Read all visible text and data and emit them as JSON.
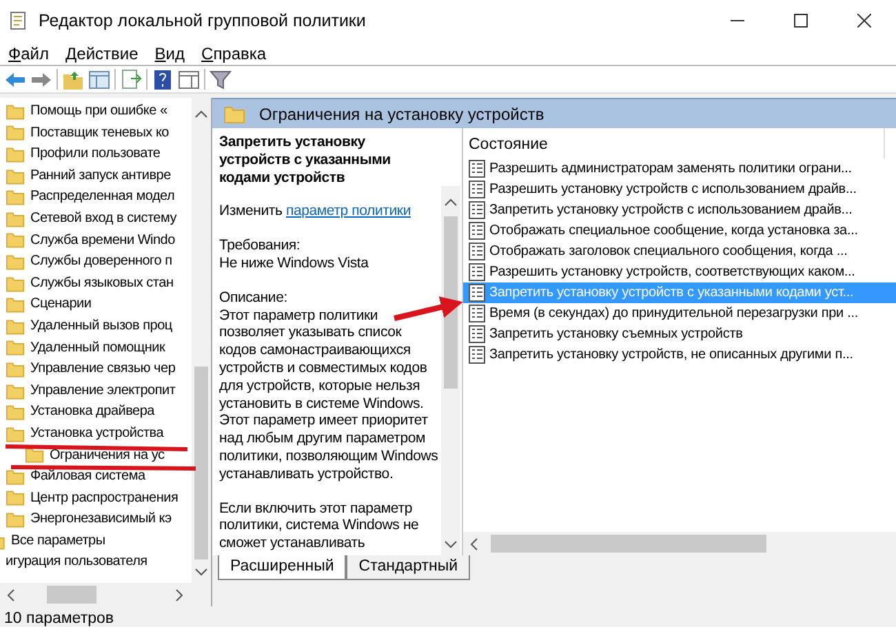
{
  "window": {
    "title": "Редактор локальной групповой политики"
  },
  "menu": [
    "Файл",
    "Действие",
    "Вид",
    "Справка"
  ],
  "tree": [
    {
      "label": "Помощь при ошибке «",
      "kind": "folder"
    },
    {
      "label": "Поставщик теневых ко",
      "kind": "folder"
    },
    {
      "label": "Профили пользовате",
      "kind": "folder"
    },
    {
      "label": "Ранний запуск антивре",
      "kind": "folder"
    },
    {
      "label": "Распределенная модел",
      "kind": "folder"
    },
    {
      "label": "Сетевой вход в систему",
      "kind": "folder"
    },
    {
      "label": "Служба времени Windo",
      "kind": "folder"
    },
    {
      "label": "Службы доверенного п",
      "kind": "folder"
    },
    {
      "label": "Службы языковых стан",
      "kind": "folder"
    },
    {
      "label": "Сценарии",
      "kind": "folder"
    },
    {
      "label": "Удаленный вызов проц",
      "kind": "folder"
    },
    {
      "label": "Удаленный помощник",
      "kind": "folder"
    },
    {
      "label": "Управление связью чер",
      "kind": "folder"
    },
    {
      "label": "Управление электропит",
      "kind": "folder"
    },
    {
      "label": "Установка драйвера",
      "kind": "folder"
    },
    {
      "label": "Установка устройства",
      "kind": "folder",
      "children": [
        {
          "label": "Ограничения на ус",
          "kind": "folder"
        }
      ]
    },
    {
      "label": "Файловая система",
      "kind": "folder"
    },
    {
      "label": "Центр распространения",
      "kind": "folder"
    },
    {
      "label": "Энергонезависимый кэ",
      "kind": "folder"
    },
    {
      "label": "Все параметры",
      "kind": "settings"
    },
    {
      "label": "игурация пользователя",
      "kind": "root"
    }
  ],
  "pane_header": "Ограничения на установку устройств",
  "details": {
    "title": "Запретить установку устройств с указанными кодами устройств",
    "edit_prefix": "Изменить",
    "edit_link": "параметр политики",
    "requirements_label": "Требования:",
    "requirements": "Не ниже Windows Vista",
    "description_label": "Описание:",
    "description": "Этот параметр политики позволяет указывать список кодов самонастраивающихся устройств и совместимых кодов для устройств, которые нельзя установить в системе Windows. Этот параметр имеет приоритет над любым другим параметром политики, позволяющим Windows устанавливать устройство.",
    "description_2": "Если включить этот параметр политики, система Windows не сможет устанавливать"
  },
  "list": {
    "column": "Состояние",
    "rows": [
      {
        "label": "Разрешить администраторам заменять политики ограни...",
        "selected": false
      },
      {
        "label": "Разрешить установку устройств с использованием драйв...",
        "selected": false
      },
      {
        "label": "Запретить установку устройств с использованием драйв...",
        "selected": false
      },
      {
        "label": "Отображать специальное сообщение, когда установка за...",
        "selected": false
      },
      {
        "label": "Отображать заголовок специального сообщения, когда ...",
        "selected": false
      },
      {
        "label": "Разрешить установку устройств, соответствующих каком...",
        "selected": false
      },
      {
        "label": "Запретить установку устройств с указанными кодами уст...",
        "selected": true
      },
      {
        "label": "Время (в секундах) до принудительной перезагрузки при ...",
        "selected": false
      },
      {
        "label": "Запретить установку съемных устройств",
        "selected": false
      },
      {
        "label": "Запретить установку устройств, не описанных другими п...",
        "selected": false
      }
    ]
  },
  "tabs": [
    {
      "label": "Расширенный",
      "selected": true
    },
    {
      "label": "Стандартный",
      "selected": false
    }
  ],
  "status_bar": "10 параметров"
}
